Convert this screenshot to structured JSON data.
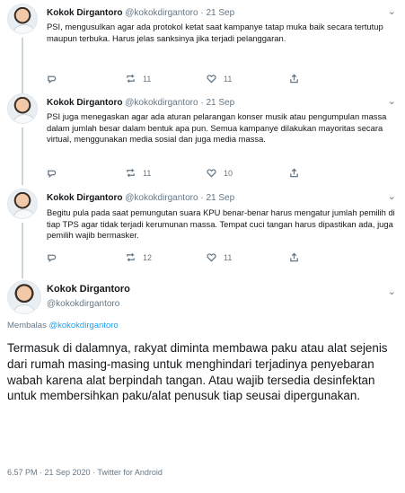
{
  "author": {
    "name": "Kokok Dirgantoro",
    "handle": "@kokokdirgantoro",
    "dot": "·"
  },
  "tweets": [
    {
      "date": "21 Sep",
      "text": "PSI, mengusulkan agar ada protokol ketat saat kampanye tatap muka baik secara tertutup maupun terbuka. Harus jelas sanksinya jika terjadi pelanggaran.",
      "replies": "",
      "retweets": "11",
      "likes": "11"
    },
    {
      "date": "21 Sep",
      "text": "PSI juga menegaskan agar ada aturan pelarangan konser musik atau pengumpulan massa dalam jumlah besar dalam bentuk apa pun. Semua kampanye dilakukan mayoritas secara virtual, menggunakan media sosial dan juga media massa.",
      "replies": "",
      "retweets": "11",
      "likes": "10"
    },
    {
      "date": "21 Sep",
      "text": "Begitu pula pada saat pemungutan suara KPU benar-benar harus mengatur jumlah pemilih di tiap TPS agar tidak terjadi kerumunan massa. Tempat cuci tangan harus dipastikan ada, juga pemilih wajib bermasker.",
      "replies": "",
      "retweets": "12",
      "likes": "11"
    }
  ],
  "main": {
    "reply_prefix": "Membalas",
    "reply_handle": "@kokokdirgantoro",
    "text": "Termasuk di dalamnya, rakyat diminta membawa paku atau alat sejenis dari rumah masing-masing untuk menghindari terjadinya penyebaran wabah karena alat berpindah tangan. Atau wajib tersedia desinfektan untuk membersihkan paku/alat penusuk tiap seusai dipergunakan.",
    "meta": "6.57 PM · 21 Sep 2020 · Twitter for Android"
  },
  "icons": {
    "reply": "reply-icon",
    "retweet": "retweet-icon",
    "like": "heart-icon",
    "share": "share-icon",
    "more": "chevron-down-icon"
  },
  "colors": {
    "link": "#1da1f2",
    "muted": "#657786",
    "text": "#14171a",
    "thread_line": "#ccd6dd"
  }
}
